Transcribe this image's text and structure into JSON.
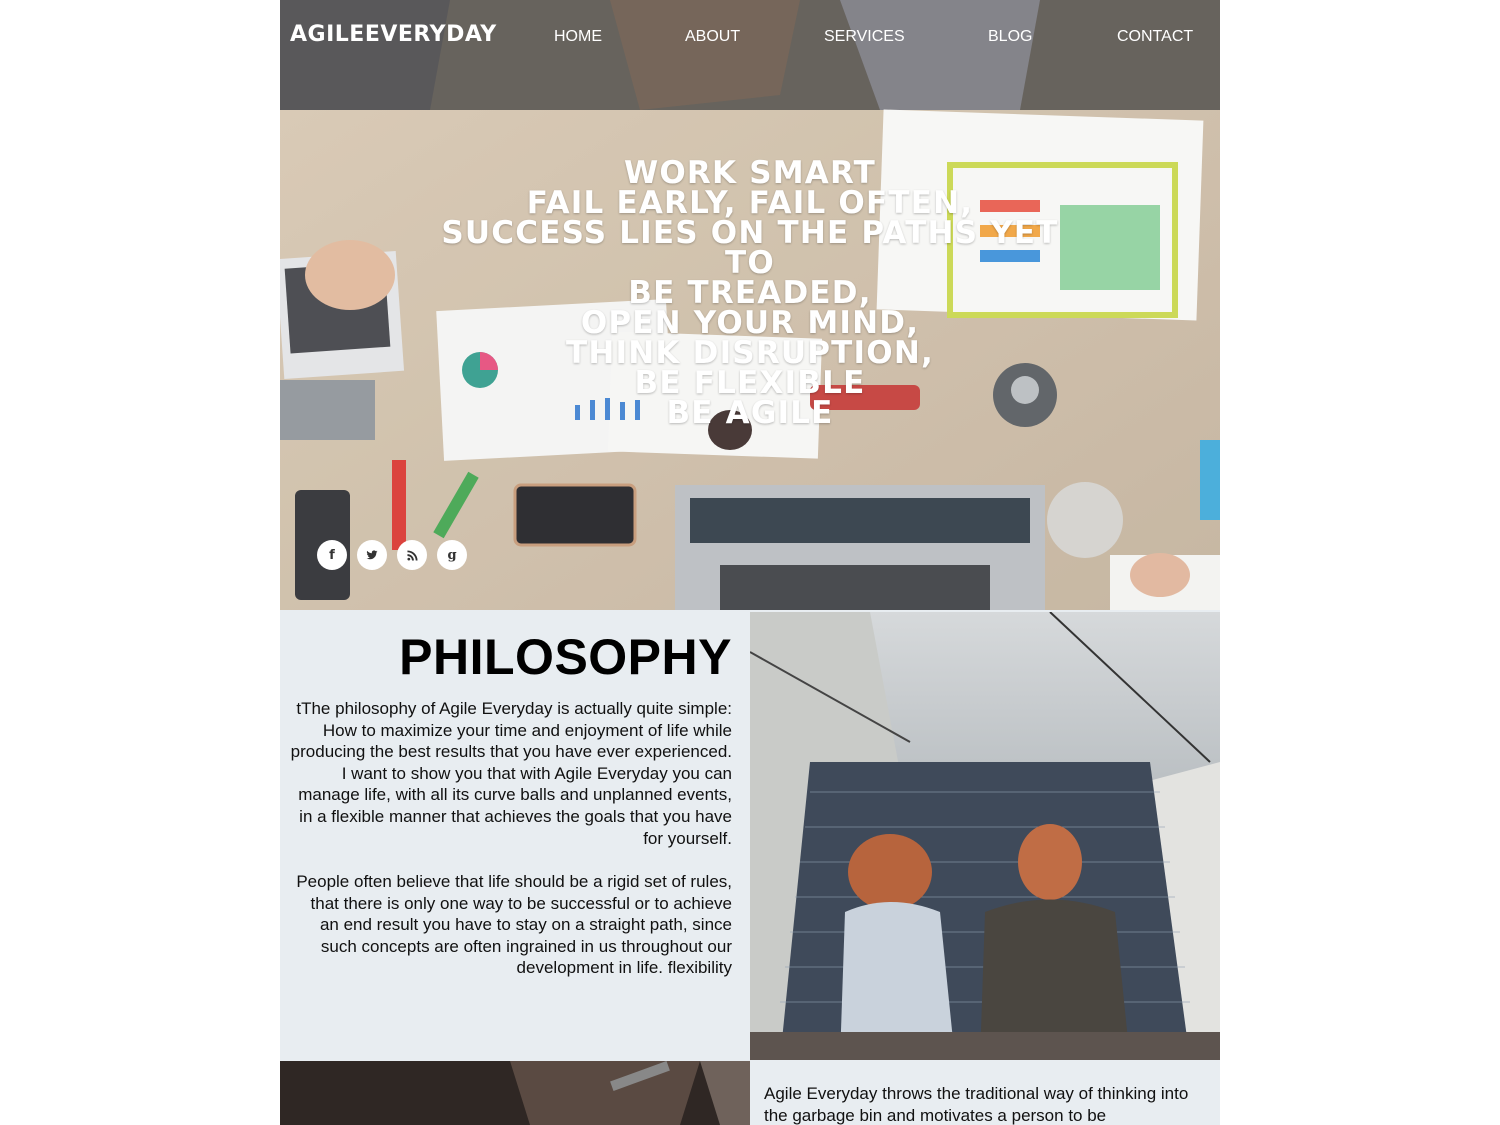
{
  "brand": {
    "logo": "AGILEEVERYDAY"
  },
  "nav": {
    "items": [
      {
        "label": "HOME"
      },
      {
        "label": "ABOUT"
      },
      {
        "label": "SERVICES"
      },
      {
        "label": "BLOG"
      },
      {
        "label": "CONTACT"
      }
    ]
  },
  "hero": {
    "slogan_lines": [
      "Work smart",
      "Fail early, fail often,",
      "Success lies on the paths yet to",
      "be treaded,",
      "Open your mind,",
      "Think disruption,",
      "Be flexible",
      "Be agile"
    ],
    "social": [
      {
        "icon": "facebook-icon",
        "glyph": "f"
      },
      {
        "icon": "twitter-icon",
        "glyph": "t"
      },
      {
        "icon": "rss-icon",
        "glyph": "rss"
      },
      {
        "icon": "google-icon",
        "glyph": "g"
      }
    ]
  },
  "philosophy": {
    "title": "PHILOSOPHY",
    "paragraph1": "tThe philosophy of Agile Everyday is actually quite simple: How to maximize your time and enjoyment of life while producing the best results that you have ever experienced. I want to show you that with Agile Everyday you can manage life, with all its curve balls and unplanned events, in a flexible manner that achieves the goals that you have for yourself.",
    "paragraph2": "People often believe that life should be a rigid set of rules, that there is only one way to be successful or to achieve an end result you have to stay on a straight path, since such concepts are often ingrained in us throughout our development in life. flexibility"
  },
  "bottom": {
    "paragraph": "Agile Everyday throws the traditional way of thinking into the garbage bin and motivates a person to be"
  },
  "colors": {
    "panel_bg": "#e8edf1",
    "nav_text": "#ffffff",
    "heading": "#000000"
  }
}
